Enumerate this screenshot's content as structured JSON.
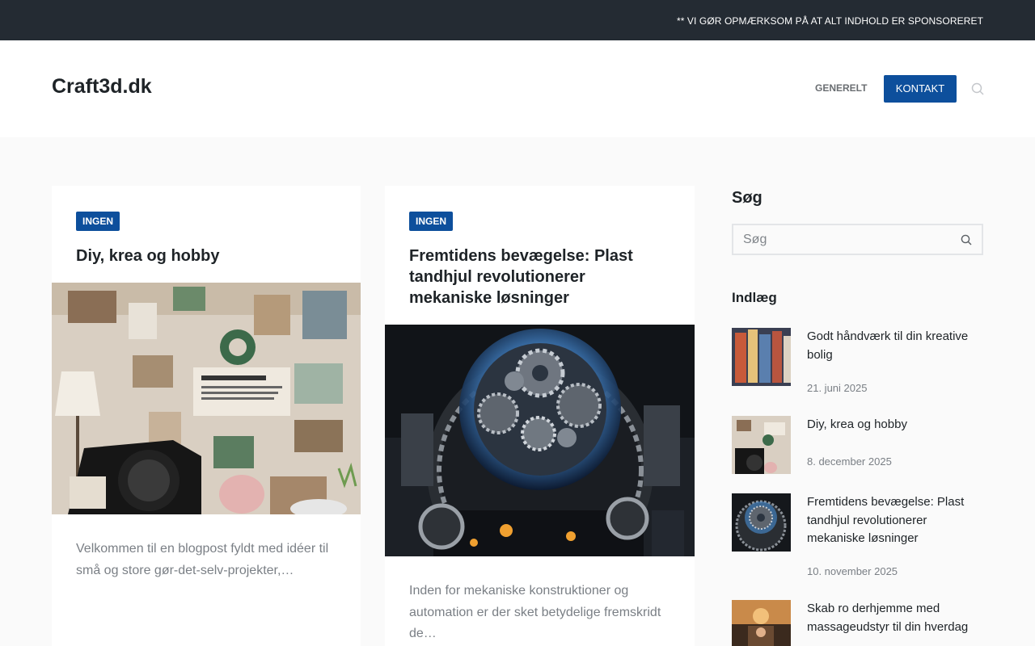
{
  "topbar": {
    "notice": "** VI GØR OPMÆRKSOM PÅ AT ALT INDHOLD ER SPONSORERET"
  },
  "header": {
    "site_title": "Craft3d.dk",
    "nav": {
      "generelt": "GENERELT",
      "kontakt": "KONTAKT"
    },
    "search_icon": "search-icon"
  },
  "posts": [
    {
      "category": "INGEN",
      "title": "Diy, krea og hobby",
      "image": "craft-workspace-camera-photo",
      "excerpt": "Velkommen til en blogpost fyldt med idéer til små og store gør-det-selv-projekter,…"
    },
    {
      "category": "INGEN",
      "title": "Fremtidens bevægelse: Plast tandhjul revolutionerer mekaniske løsninger",
      "image": "glowing-gears-sphere-photo",
      "excerpt": "Inden for mekaniske konstruktioner og automation er der sket betydelige fremskridt de…"
    }
  ],
  "sidebar": {
    "search_heading": "Søg",
    "search_placeholder": "Søg",
    "posts_heading": "Indlæg",
    "recent": [
      {
        "title": "Godt håndværk til din kreative bolig",
        "date": "21. juni 2025",
        "thumb": "textiles-thumb"
      },
      {
        "title": "Diy, krea og hobby",
        "date": "8. december 2025",
        "thumb": "craft-thumb"
      },
      {
        "title": "Fremtidens bevægelse: Plast tandhjul revolutionerer mekaniske løsninger",
        "date": "10. november 2025",
        "thumb": "gears-thumb"
      },
      {
        "title": "Skab ro derhjemme med massageudstyr til din hverdag",
        "date": "",
        "thumb": "massage-thumb"
      }
    ]
  },
  "colors": {
    "accent": "#0d4f9c",
    "topbar": "#242b33",
    "page_bg": "#fafafa"
  }
}
